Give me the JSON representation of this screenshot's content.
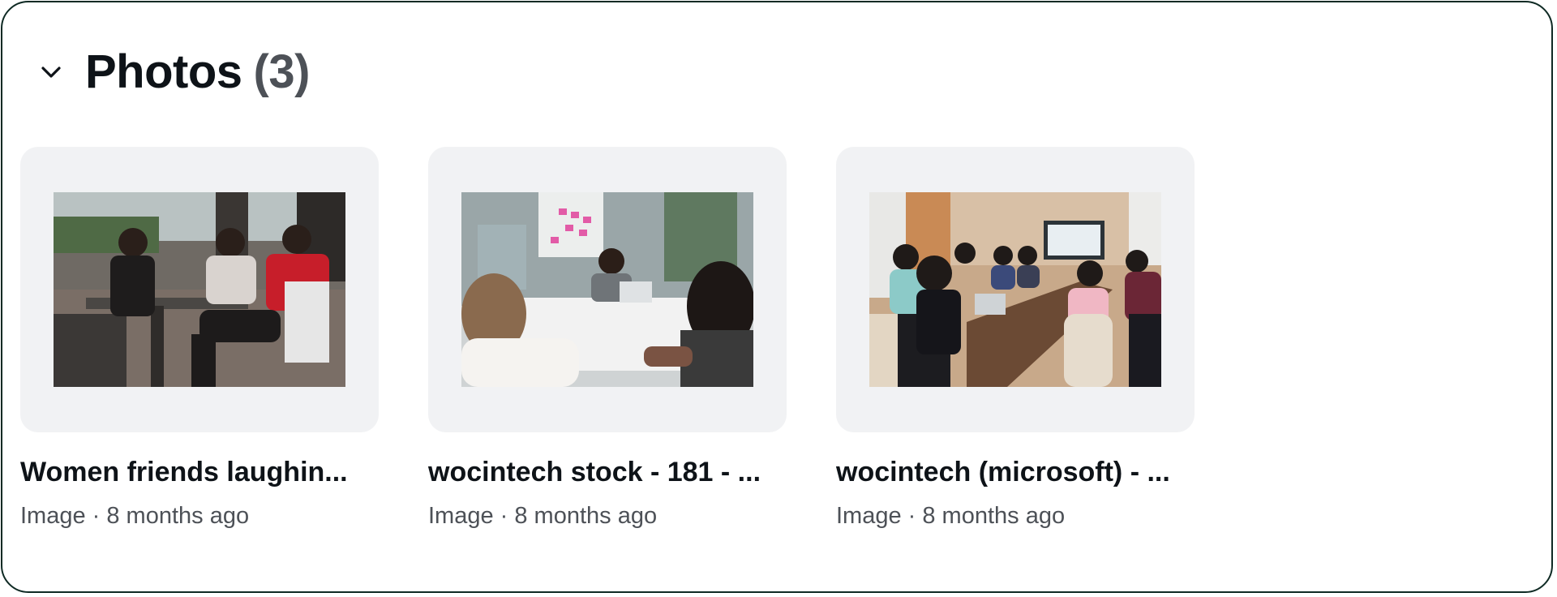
{
  "section": {
    "title": "Photos",
    "count": "(3)",
    "chevron_icon": "chevron-down-icon"
  },
  "photos": [
    {
      "title": "Women friends laughin...",
      "meta": "Image · 8 months ago",
      "thumbnail": "photo-women-friends-laughing"
    },
    {
      "title": "wocintech stock - 181 - ...",
      "meta": "Image · 8 months ago",
      "thumbnail": "photo-wocintech-stock-181"
    },
    {
      "title": "wocintech (microsoft) - ...",
      "meta": "Image · 8 months ago",
      "thumbnail": "photo-wocintech-microsoft"
    }
  ],
  "colors": {
    "border": "#0f2a24",
    "card_background": "#f1f2f4",
    "title_text": "#0e1318",
    "secondary_text": "#4d5157"
  }
}
